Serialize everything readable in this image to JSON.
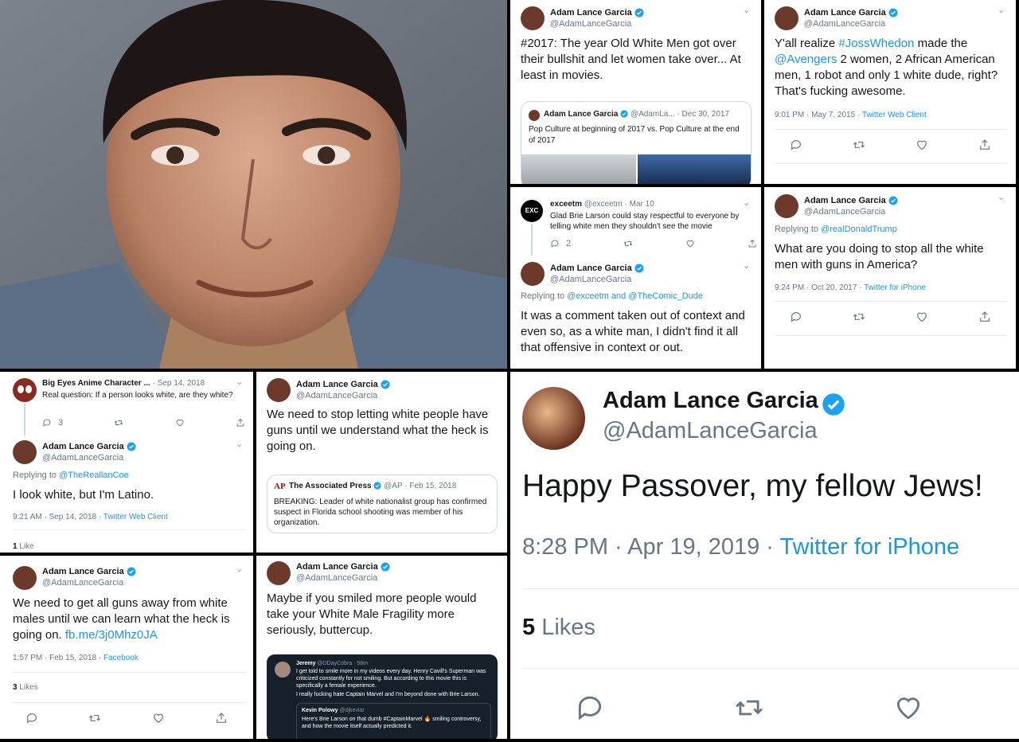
{
  "common": {
    "name": "Adam Lance Garcia",
    "handle": "@AdamLanceGarcia",
    "caret": "⌄"
  },
  "colors": {
    "link": "#1b95e0",
    "muted": "#657786",
    "verified": "#1da1f2",
    "background": "#000000"
  },
  "t1": {
    "text": "#2017: The year Old White Men got over their bullshit and let women take over... At least in movies.",
    "quote": {
      "name": "Adam Lance Garcia",
      "handle_date": "@AdamLa... · Dec 30, 2017",
      "text": "Pop Culture at beginning of 2017 vs. Pop Culture at the end of 2017"
    }
  },
  "t2": {
    "text_a": "Y'all realize ",
    "hashtag": "#JossWhedon",
    "text_b": " made the ",
    "mention": "@Avengers",
    "text_c": " 2 women, 2 African American men, 1 robot and only 1 white dude, right? That's fucking awesome.",
    "time": "9:01 PM · May 7, 2015 · ",
    "source": "Twitter Web Client"
  },
  "t3": {
    "parent": {
      "name": "exceetm",
      "handle_date": "@exceetm · Mar 10",
      "avatar_text": "EXC",
      "text": "Glad Brie Larson could stay respectful to everyone by telling white men they shouldn't see the movie",
      "replies": "2"
    },
    "replying_prefix": "Replying to ",
    "replying_to": "@exceetm and @TheComic_Dude",
    "text": "It was a comment taken out of context and even so, as a white man, I didn't find it all that offensive in context or out."
  },
  "t4": {
    "replying_prefix": "Replying to ",
    "replying_to": "@realDonaldTrump",
    "text": "What are you doing to stop all the white men with guns in America?",
    "time": "9:24 PM · Oct 20, 2017 · ",
    "source": "Twitter for iPhone"
  },
  "t5": {
    "parent": {
      "name": "Big Eyes Anime Character ...",
      "date": "· Sep 14, 2018",
      "text": "Real question: If a person looks white, are they white?",
      "replies": "3"
    },
    "replying_prefix": "Replying to ",
    "replying_to": "@TheReallanCoe",
    "text": "I look white, but I'm Latino.",
    "time": "9:21 AM · Sep 14, 2018 · ",
    "source": "Twitter Web Client",
    "likes_count": "1",
    "likes_label": "Like"
  },
  "t6": {
    "text": "We need to stop letting white people have guns until we understand what the heck is going on.",
    "quote": {
      "logo": "AP",
      "name": "The Associated Press",
      "handle_date": "@AP · Feb 15, 2018",
      "text": "BREAKING: Leader of white nationalist group has confirmed suspect in Florida school shooting was member of his organization."
    }
  },
  "t7": {
    "text": "We need to get all guns away from white males until we can learn what the heck is going on. ",
    "link": "fb.me/3j0Mhz0JA",
    "time": "1:57 PM · Feb 15, 2018 · ",
    "source": "Facebook",
    "likes_count": "3",
    "likes_label": "Likes"
  },
  "t8": {
    "text": "Maybe if you smiled more people would take your White Male Fragility more seriously, buttercup.",
    "embed": {
      "name": "Jeremy",
      "handle_date": "@DDayCobra · 58m",
      "text1": "I get told to smile more in my videos every day. Henry Cavill's Superman was criticized constantly for not smiling. But according to this movie this is specifically a female experience.",
      "text2": "I really fucking hate Captain Marvel and I'm beyond done with Brie Larson.",
      "inner_name": "Kevin Polowy",
      "inner_handle": "@djkevlar",
      "inner_text": "Here's Brie Larson on that dumb #CaptainMarvel 🔥 smiling controversy, and how the movie itself actually predicted it."
    }
  },
  "t9": {
    "text": "Happy Passover, my fellow Jews!",
    "time": "8:28 PM · Apr 19, 2019 · ",
    "source": "Twitter for iPhone",
    "likes_count": "5",
    "likes_label": "Likes"
  }
}
